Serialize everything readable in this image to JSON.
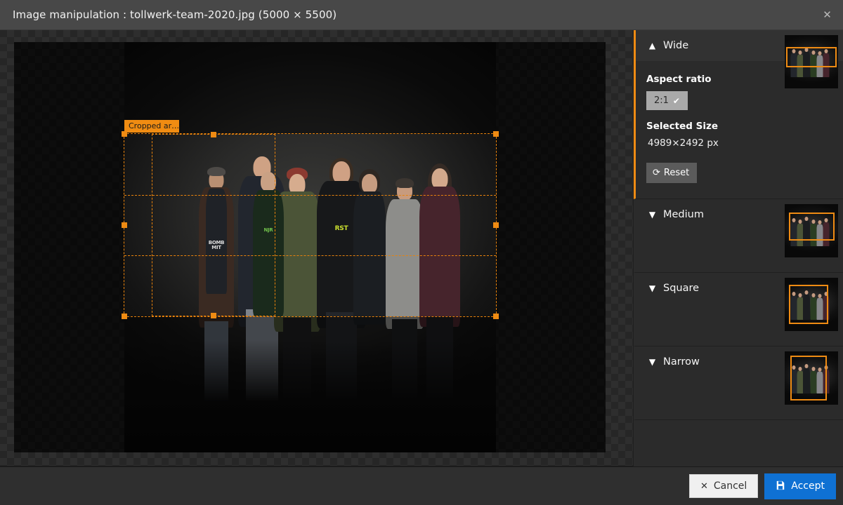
{
  "titlebar": {
    "title": "Image manipulation : tollwerk-team-2020.jpg (5000 × 5500)",
    "close_icon": "close-icon",
    "close_glyph": "✕"
  },
  "canvas": {
    "crop_label": "Cropped ar…",
    "crop_label_full": "Cropped area"
  },
  "sidebar": {
    "panels": [
      {
        "label": "Wide",
        "expanded": true,
        "chevron": "▲",
        "aspect_ratio_label": "Aspect ratio",
        "aspect_ratio_value": "2:1",
        "aspect_ratio_tick": "✔",
        "selected_size_label": "Selected Size",
        "selected_size_value": "4989×2492 px",
        "reset_label": "Reset",
        "reset_icon": "refresh-icon",
        "reset_glyph": "⟳"
      },
      {
        "label": "Medium",
        "expanded": false,
        "chevron": "▼"
      },
      {
        "label": "Square",
        "expanded": false,
        "chevron": "▼"
      },
      {
        "label": "Narrow",
        "expanded": false,
        "chevron": "▼"
      }
    ]
  },
  "footer": {
    "cancel_label": "Cancel",
    "cancel_icon": "close-icon",
    "cancel_glyph": "✕",
    "accept_label": "Accept",
    "accept_icon": "save-icon",
    "accept_glyph": "🖫"
  },
  "colors": {
    "accent": "#ef8b13",
    "accept_blue": "#0f71d3",
    "panel_bg": "#2b2b2b",
    "header_bg": "#323232",
    "titlebar_bg": "#484848"
  }
}
